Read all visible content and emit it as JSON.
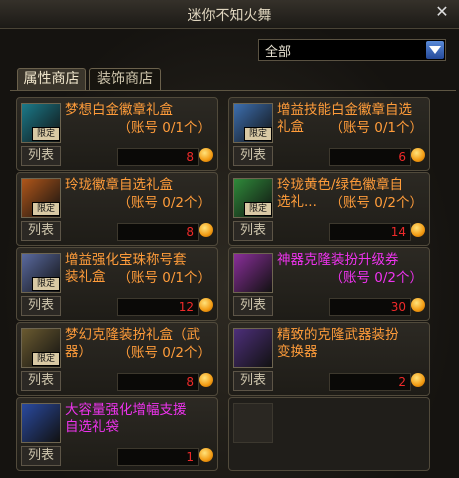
{
  "window": {
    "title": "迷你不知火舞",
    "close_icon": "close-icon"
  },
  "filter": {
    "selected": "全部"
  },
  "tabs": [
    {
      "label": "属性商店",
      "active": true
    },
    {
      "label": "装饰商店",
      "active": false
    }
  ],
  "items": [
    {
      "name": "梦想白金徽章礼盒",
      "account": "（账号 0/1个）",
      "price": "8",
      "tag": "限定",
      "list_label": "列表",
      "color": "#ff9c3a"
    },
    {
      "name": "增益技能白金徽章自选\n礼盒",
      "account": "（账号 0/1个）",
      "price": "6",
      "tag": "限定",
      "list_label": "列表",
      "color": "#ff9c3a"
    },
    {
      "name": "玲珑徽章自选礼盒",
      "account": "（账号 0/2个）",
      "price": "8",
      "tag": "限定",
      "list_label": "列表",
      "color": "#ff9c3a"
    },
    {
      "name": "玲珑黄色/绿色徽章自\n选礼...",
      "account": "（账号 0/2个）",
      "price": "14",
      "tag": "限定",
      "list_label": "列表",
      "color": "#ff9c3a"
    },
    {
      "name": "增益强化宝珠称号套\n装礼盒",
      "account": "（账号 0/1个）",
      "price": "12",
      "tag": "限定",
      "list_label": "列表",
      "color": "#ff9c3a"
    },
    {
      "name": "神器克隆装扮升级券",
      "account": "（账号 0/2个）",
      "price": "30",
      "tag": "",
      "list_label": "列表",
      "color": "#ee33ee"
    },
    {
      "name": "梦幻克隆装扮礼盒（武\n器）",
      "account": "（账号 0/2个）",
      "price": "8",
      "tag": "限定",
      "list_label": "列表",
      "color": "#ff9c3a"
    },
    {
      "name": "精致的克隆武器装扮\n变换器",
      "account": "",
      "price": "2",
      "tag": "",
      "list_label": "列表",
      "color": "#ff9c3a"
    },
    {
      "name": "大容量强化增幅支援\n自选礼袋",
      "account": "",
      "price": "1",
      "tag": "",
      "list_label": "列表",
      "color": "#ee33ee"
    }
  ]
}
